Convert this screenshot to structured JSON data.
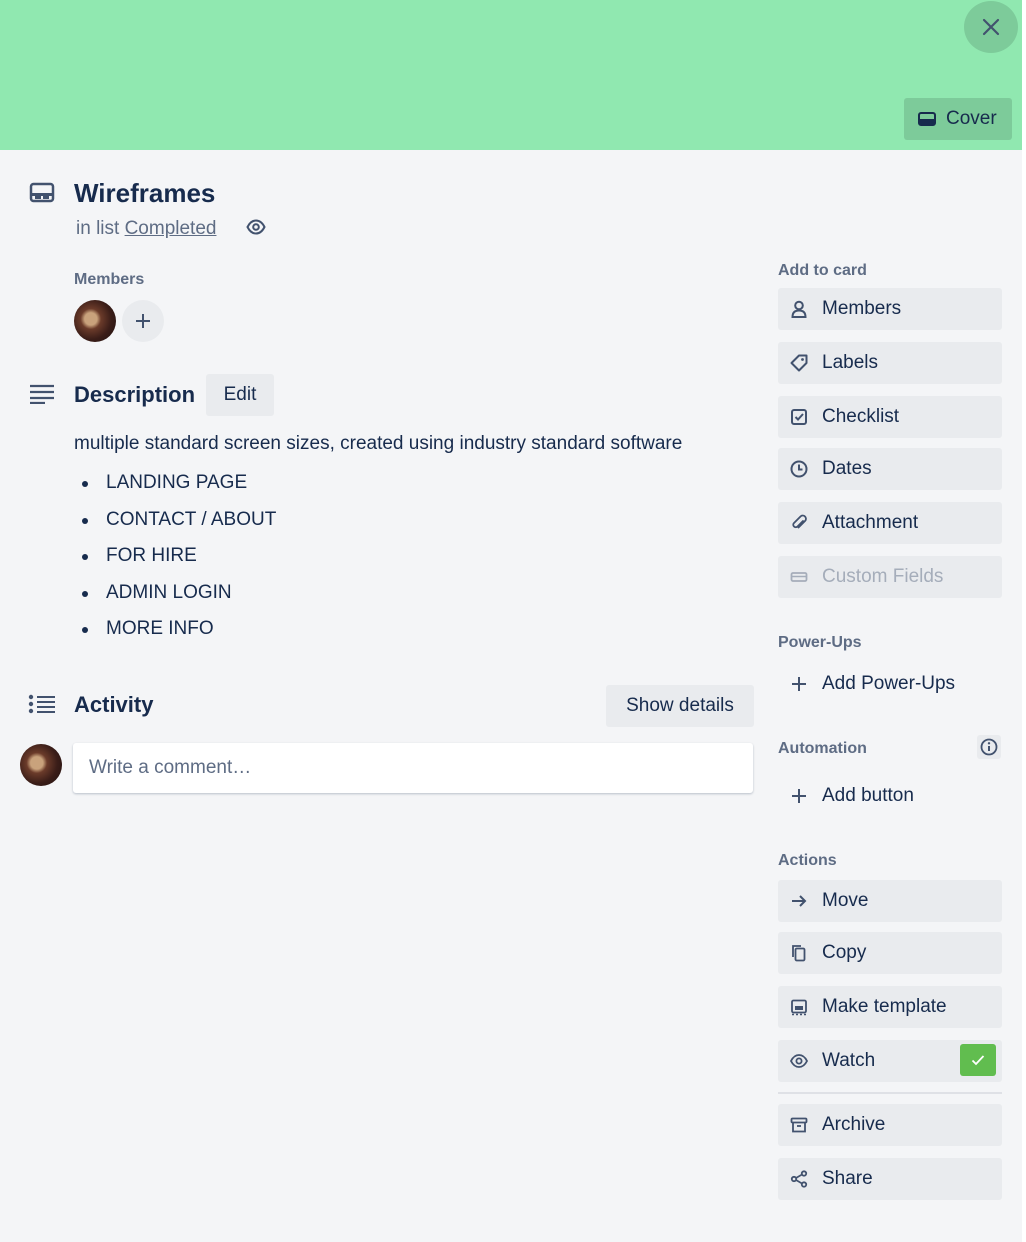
{
  "card": {
    "title": "Wireframes",
    "in_list_prefix": "in list",
    "list_name": "Completed",
    "cover_label": "Cover"
  },
  "members": {
    "label": "Members"
  },
  "description": {
    "heading": "Description",
    "edit_label": "Edit",
    "text": "multiple standard screen sizes, created using industry standard software",
    "items": [
      "LANDING PAGE",
      "CONTACT / ABOUT",
      "FOR HIRE",
      "ADMIN LOGIN",
      "MORE INFO"
    ]
  },
  "activity": {
    "heading": "Activity",
    "show_details_label": "Show details",
    "comment_placeholder": "Write a comment…"
  },
  "sidebar": {
    "add_to_card_label": "Add to card",
    "add_to_card": [
      "Members",
      "Labels",
      "Checklist",
      "Dates",
      "Attachment",
      "Custom Fields"
    ],
    "powerups_label": "Power-Ups",
    "add_powerups": "Add Power-Ups",
    "automation_label": "Automation",
    "add_button": "Add button",
    "actions_label": "Actions",
    "actions": [
      "Move",
      "Copy",
      "Make template",
      "Watch",
      "Archive",
      "Share"
    ]
  },
  "colors": {
    "cover": "#90e8b0",
    "background": "#f4f5f7",
    "button": "#e9ebee",
    "watch_check": "#61bd4f"
  }
}
